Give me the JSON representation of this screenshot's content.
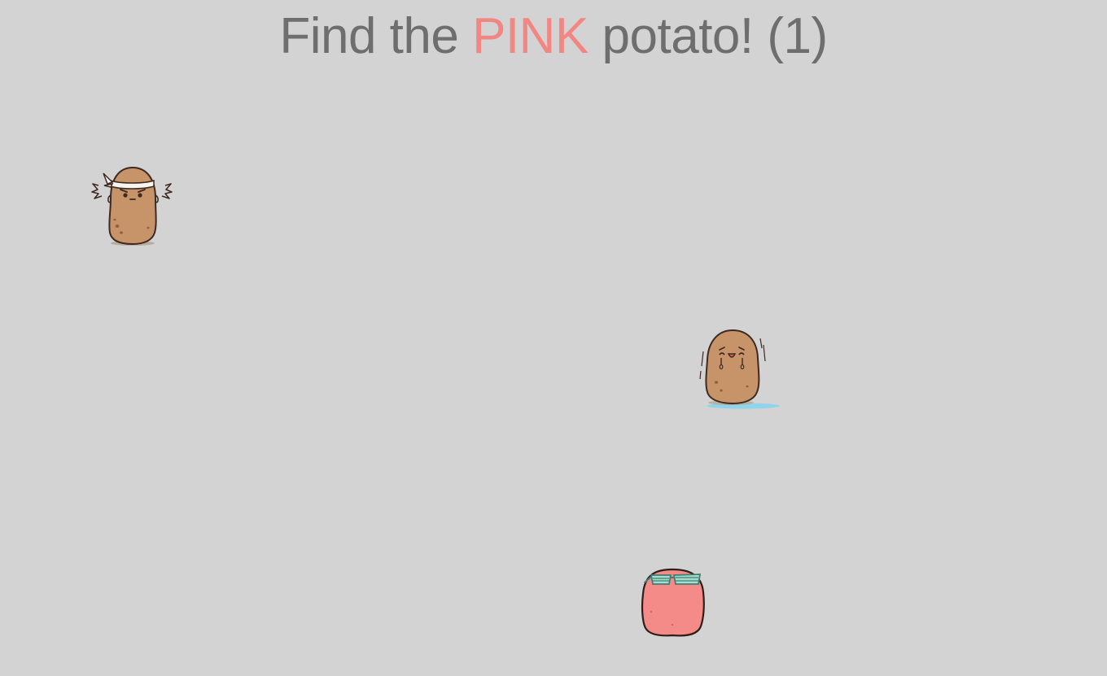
{
  "title": {
    "prefix": "Find the ",
    "target_word": "PINK",
    "suffix": " potato!",
    "round": "(1)"
  },
  "colors": {
    "background": "#d3d3d3",
    "title_text": "#6e6e6e",
    "target_word": "#f28683",
    "brown_potato": "#c69468",
    "pink_potato": "#f48b89",
    "outline": "#3e2a22"
  },
  "potatoes": [
    {
      "name": "potato-headband",
      "color": "brown",
      "accessory": "headband-icon",
      "is_target": false
    },
    {
      "name": "potato-crying",
      "color": "brown",
      "accessory": "tears-puddle-icon",
      "is_target": false
    },
    {
      "name": "potato-sunglasses",
      "color": "pink",
      "accessory": "sunglasses-icon",
      "is_target": true
    }
  ]
}
